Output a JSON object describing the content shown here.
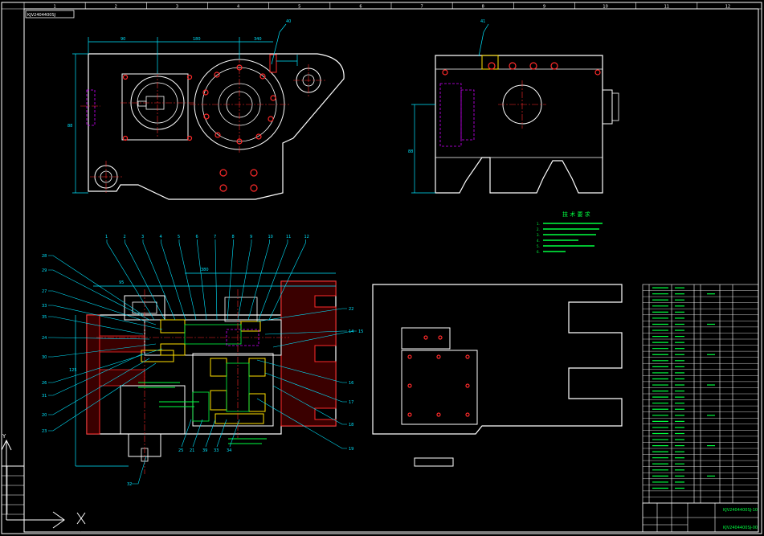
{
  "colors": {
    "background": "#000000",
    "frame": "#ffffff",
    "leader": "#00e5ff",
    "part_red": "#ff2a2a",
    "note_green": "#00ff40",
    "hidden_magenta": "#d000ff",
    "bearing_yellow": "#ffe000",
    "axis_white": "#ffffff"
  },
  "drawing": {
    "sheet_code": "KJV2404400SJ",
    "zone_numbers": [
      "1",
      "2",
      "3",
      "4",
      "5",
      "6",
      "7",
      "8",
      "9",
      "10",
      "11",
      "12"
    ],
    "top_view_balloon": "40",
    "side_view_balloon": "41",
    "top_dimensions": [
      "90",
      "180",
      "340"
    ],
    "top_side_dim": "88",
    "side_view_dim": "88",
    "section_dims": [
      "95",
      "380",
      "125"
    ],
    "technical_notes": {
      "title": "技 术 要 求",
      "lines": [
        "1.",
        "2.",
        "3.",
        "4.",
        "5.",
        "6."
      ]
    },
    "part_balloons_top": [
      "1",
      "2",
      "3",
      "4",
      "5",
      "6",
      "7",
      "8",
      "9",
      "10",
      "11",
      "12"
    ],
    "part_balloons_left": [
      "28",
      "29",
      "27",
      "33",
      "35",
      "24",
      "30",
      "26",
      "31",
      "20",
      "23"
    ],
    "part_balloons_right": [
      "22",
      "14",
      "15",
      "16",
      "17",
      "18",
      "19"
    ],
    "part_balloons_bottom": [
      "25",
      "21",
      "39",
      "33",
      "34"
    ],
    "part_balloons_base": [
      "32"
    ],
    "parts_list_rows": 36,
    "title_block_name": "KJV2404400SJ-10",
    "title_block_drawing_no": "KJV2404400SJ-00",
    "ucs_axis_label": "X",
    "ucs_y_label": "Y"
  }
}
